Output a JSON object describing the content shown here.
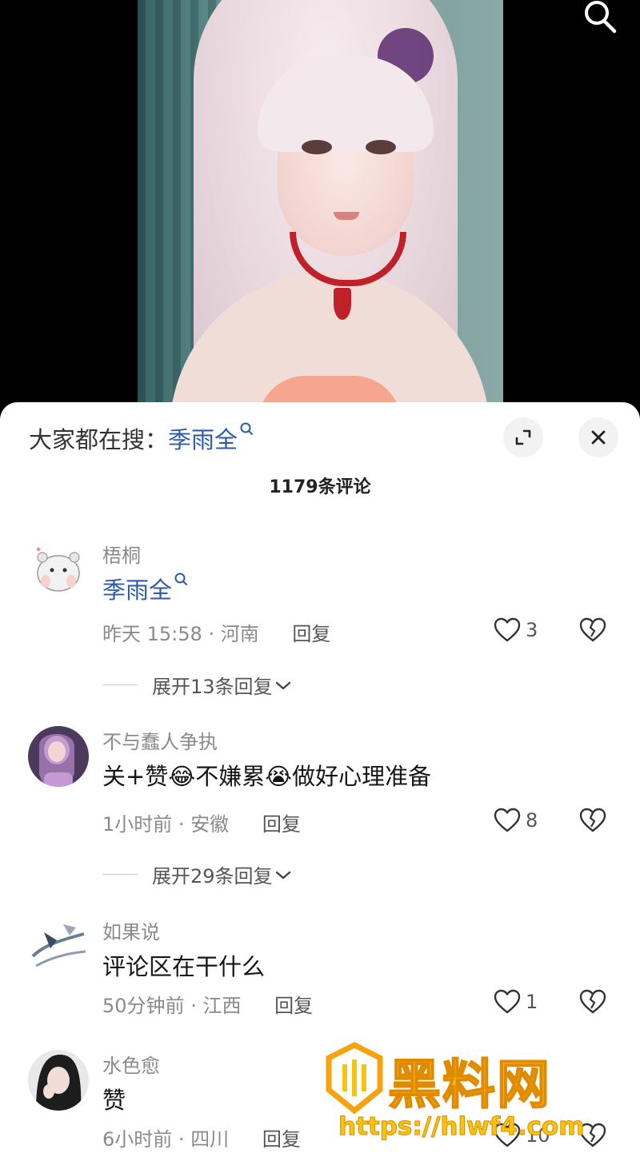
{
  "search_hint": {
    "prefix": "大家都在搜：",
    "term": "季雨全"
  },
  "comment_count": "1179条评论",
  "comments": [
    {
      "name": "梧桐",
      "text": "季雨全",
      "time": "昨天 15:58",
      "location": "河南",
      "reply_label": "回复",
      "likes": "3",
      "expand_label": "展开13条回复"
    },
    {
      "name": "不与蠢人争执",
      "text_before": "关+赞",
      "emoji1": "😂",
      "text_mid": "不嫌累",
      "emoji2": "😭",
      "text_after": "做好心理准备",
      "time": "1小时前",
      "location": "安徽",
      "reply_label": "回复",
      "likes": "8",
      "expand_label": "展开29条回复"
    },
    {
      "name": "如果说",
      "text": "评论区在干什么",
      "time": "50分钟前",
      "location": "江西",
      "reply_label": "回复",
      "likes": "1"
    },
    {
      "name": "水色愈",
      "text": "赞",
      "time": "6小时前",
      "location": "四川",
      "reply_label": "回复",
      "likes": "10"
    }
  ],
  "watermark": {
    "text": "黑料网",
    "url": "https://hlwf4.com"
  },
  "icons": {
    "search": "search-icon",
    "expand": "expand-icon",
    "close": "close-icon",
    "like": "heart-icon",
    "dislike": "broken-heart-icon",
    "chevron": "chevron-down-icon"
  },
  "colors": {
    "link": "#2e5aa8",
    "watermark": "#f6c40e"
  }
}
